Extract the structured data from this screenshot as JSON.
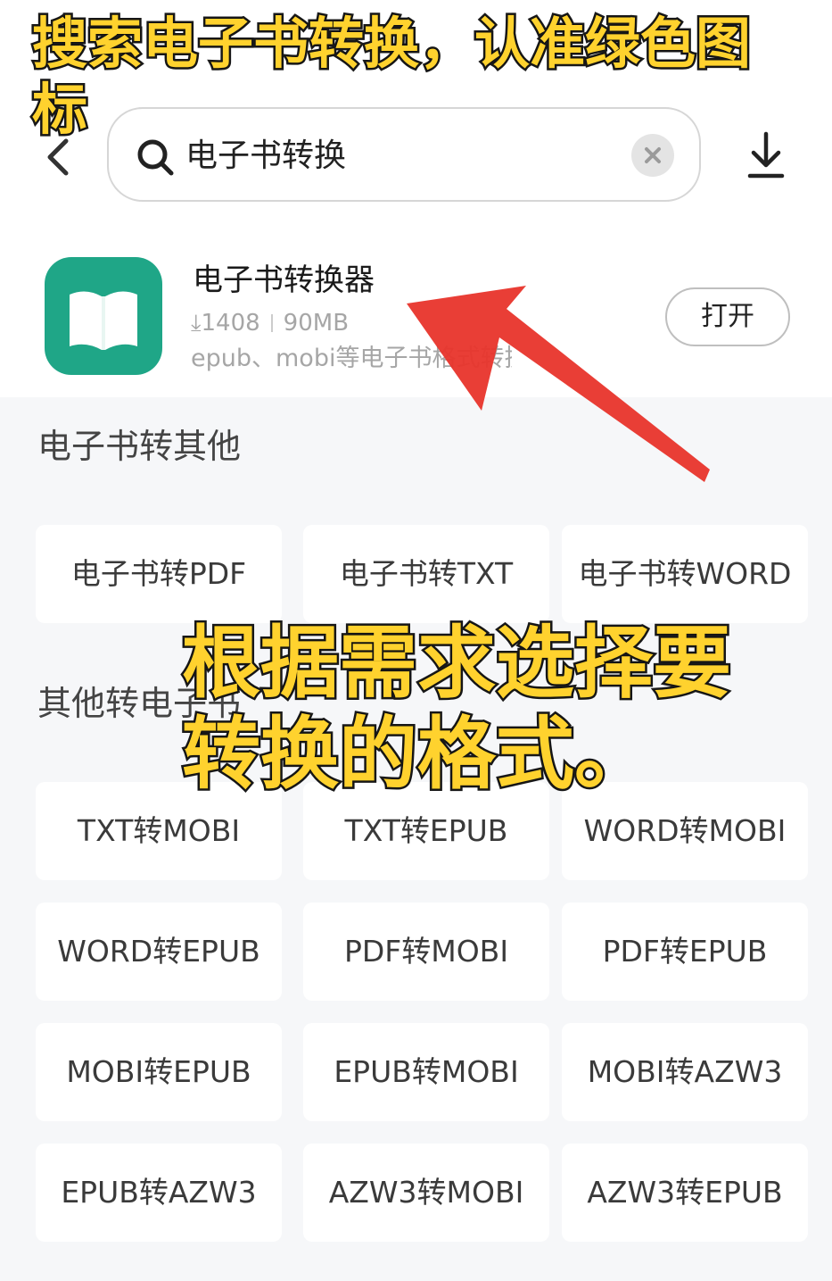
{
  "header": {
    "search_query": "电子书转换"
  },
  "app": {
    "name": "电子书转换器",
    "downloads": "1408",
    "size": "90MB",
    "description": "epub、mobi等电子书格式转换",
    "open_label": "打开",
    "icon_color": "#1fa687",
    "icon_name": "open-book-icon"
  },
  "sections": [
    {
      "title": "电子书转其他",
      "items": [
        "电子书转PDF",
        "电子书转TXT",
        "电子书转WORD"
      ]
    },
    {
      "title": "其他转电子书",
      "items": [
        "TXT转MOBI",
        "TXT转EPUB",
        "WORD转MOBI",
        "WORD转EPUB",
        "PDF转MOBI",
        "PDF转EPUB",
        "MOBI转EPUB",
        "EPUB转MOBI",
        "MOBI转AZW3",
        "EPUB转AZW3",
        "AZW3转MOBI",
        "AZW3转EPUB"
      ]
    }
  ],
  "annotations": {
    "top_caption": "搜索电子书转换，认准绿色图标",
    "middle_caption": "根据需求选择要转换的格式。",
    "caption_color": "#ffd22e",
    "arrow_color": "#e8342b"
  }
}
